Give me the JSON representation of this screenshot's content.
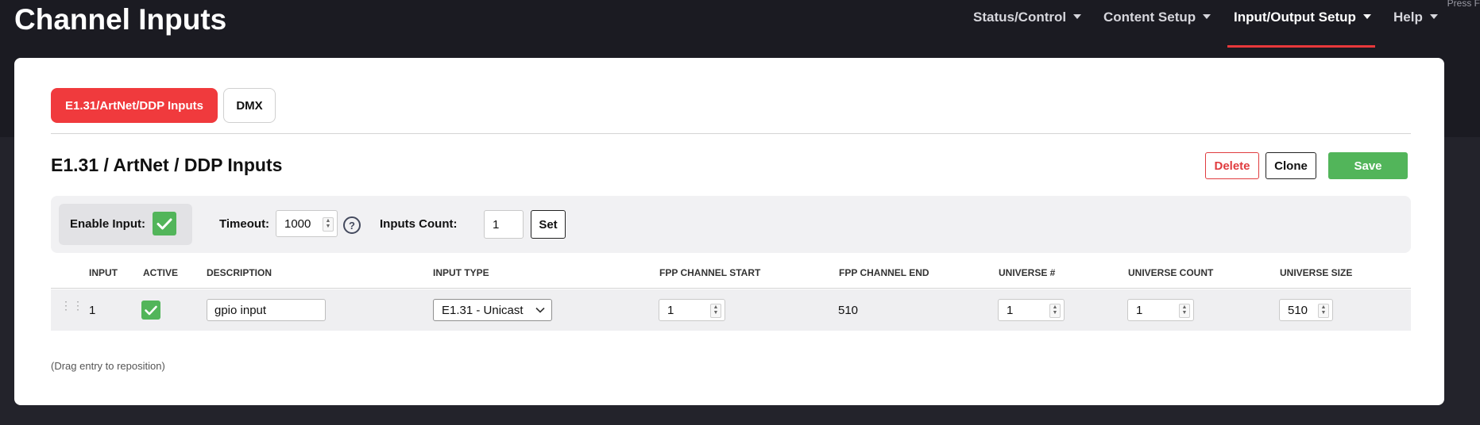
{
  "app": {
    "title": "Channel Inputs",
    "press_hint": "Press F"
  },
  "nav": {
    "items": [
      {
        "label": "Status/Control"
      },
      {
        "label": "Content Setup"
      },
      {
        "label": "Input/Output Setup",
        "active": true
      },
      {
        "label": "Help"
      }
    ]
  },
  "tabs": [
    {
      "label": "E1.31/ArtNet/DDP Inputs",
      "active": true
    },
    {
      "label": "DMX"
    }
  ],
  "section": {
    "title": "E1.31 / ArtNet / DDP Inputs",
    "delete_label": "Delete",
    "clone_label": "Clone",
    "save_label": "Save"
  },
  "settings": {
    "enable_label": "Enable Input:",
    "enable_checked": true,
    "timeout_label": "Timeout:",
    "timeout_value": "1000",
    "help_glyph": "?",
    "inputs_count_label": "Inputs Count:",
    "inputs_count_value": "1",
    "set_label": "Set"
  },
  "table": {
    "headers": [
      "INPUT",
      "ACTIVE",
      "DESCRIPTION",
      "INPUT TYPE",
      "FPP CHANNEL START",
      "FPP CHANNEL END",
      "UNIVERSE #",
      "UNIVERSE COUNT",
      "UNIVERSE SIZE"
    ],
    "rows": [
      {
        "input": "1",
        "active": true,
        "description": "gpio input",
        "input_type": "E1.31 - Unicast",
        "fpp_channel_start": "1",
        "fpp_channel_end": "510",
        "universe": "1",
        "universe_count": "1",
        "universe_size": "510"
      }
    ]
  },
  "footer_note": "(Drag entry to reposition)",
  "colors": {
    "accent_red": "#f03a3d",
    "save_green": "#52b55a",
    "header_bg": "#1b1b22"
  }
}
